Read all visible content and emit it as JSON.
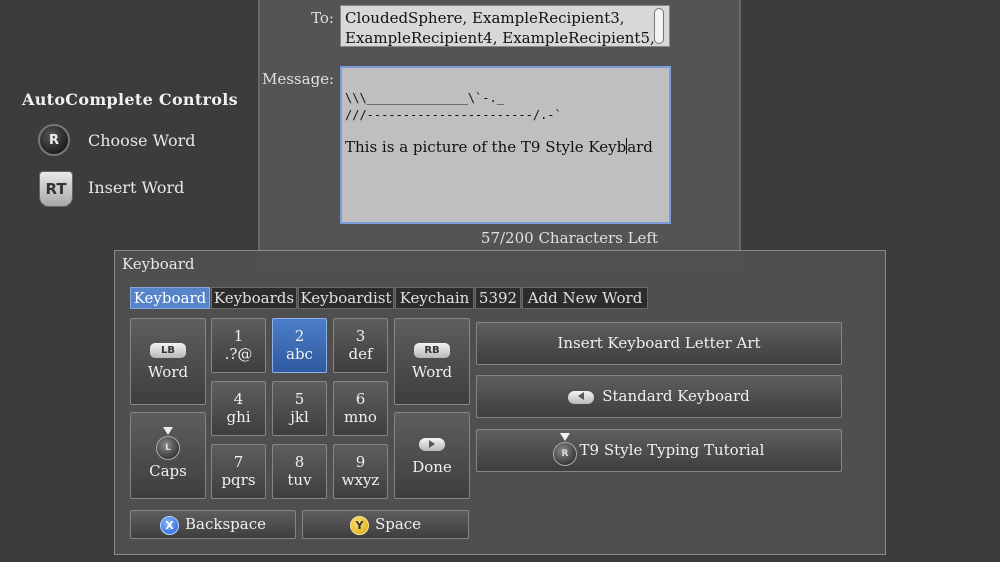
{
  "help": {
    "title": "AutoComplete Controls",
    "items": [
      {
        "button": "R",
        "label": "Choose Word"
      },
      {
        "button": "RT",
        "label": "Insert Word"
      }
    ]
  },
  "compose": {
    "to_label": "To:",
    "to_value": "CloudedSphere, ExampleRecipient3, ExampleRecipient4, ExampleRecipient5,",
    "message_label": "Message:",
    "message_art_line1": "\\\\\\______________\\`-._",
    "message_art_line2": "///-----------------------/.-`",
    "message_text_before_cursor": "This is a picture of the T9 Style Keyb",
    "message_text_after_cursor": "ard",
    "chars_left": "57/200 Characters Left"
  },
  "keyboard": {
    "title": "Keyboard",
    "tabs": [
      "Keyboard",
      "Keyboards",
      "Keyboardist",
      "Keychain",
      "5392",
      "Add New Word"
    ],
    "active_tab": 0,
    "left_word": {
      "button": "LB",
      "label": "Word"
    },
    "caps": {
      "stick": "L",
      "label": "Caps"
    },
    "right_word": {
      "button": "RB",
      "label": "Word"
    },
    "done": {
      "label": "Done"
    },
    "keys": [
      {
        "num": "1",
        "letters": ".?@"
      },
      {
        "num": "2",
        "letters": "abc"
      },
      {
        "num": "3",
        "letters": "def"
      },
      {
        "num": "4",
        "letters": "ghi"
      },
      {
        "num": "5",
        "letters": "jkl"
      },
      {
        "num": "6",
        "letters": "mno"
      },
      {
        "num": "7",
        "letters": "pqrs"
      },
      {
        "num": "8",
        "letters": "tuv"
      },
      {
        "num": "9",
        "letters": "wxyz"
      }
    ],
    "active_key": "2",
    "backspace": {
      "button": "X",
      "label": "Backspace"
    },
    "space": {
      "button": "Y",
      "label": "Space"
    },
    "actions": [
      {
        "label": "Insert Keyboard Letter Art"
      },
      {
        "label": "Standard Keyboard"
      },
      {
        "label": "T9 Style Typing Tutorial",
        "stick": "R"
      }
    ]
  },
  "colors": {
    "background": "#3c3c3c",
    "accent": "#5683c9",
    "message_border": "#7a9cd8"
  }
}
